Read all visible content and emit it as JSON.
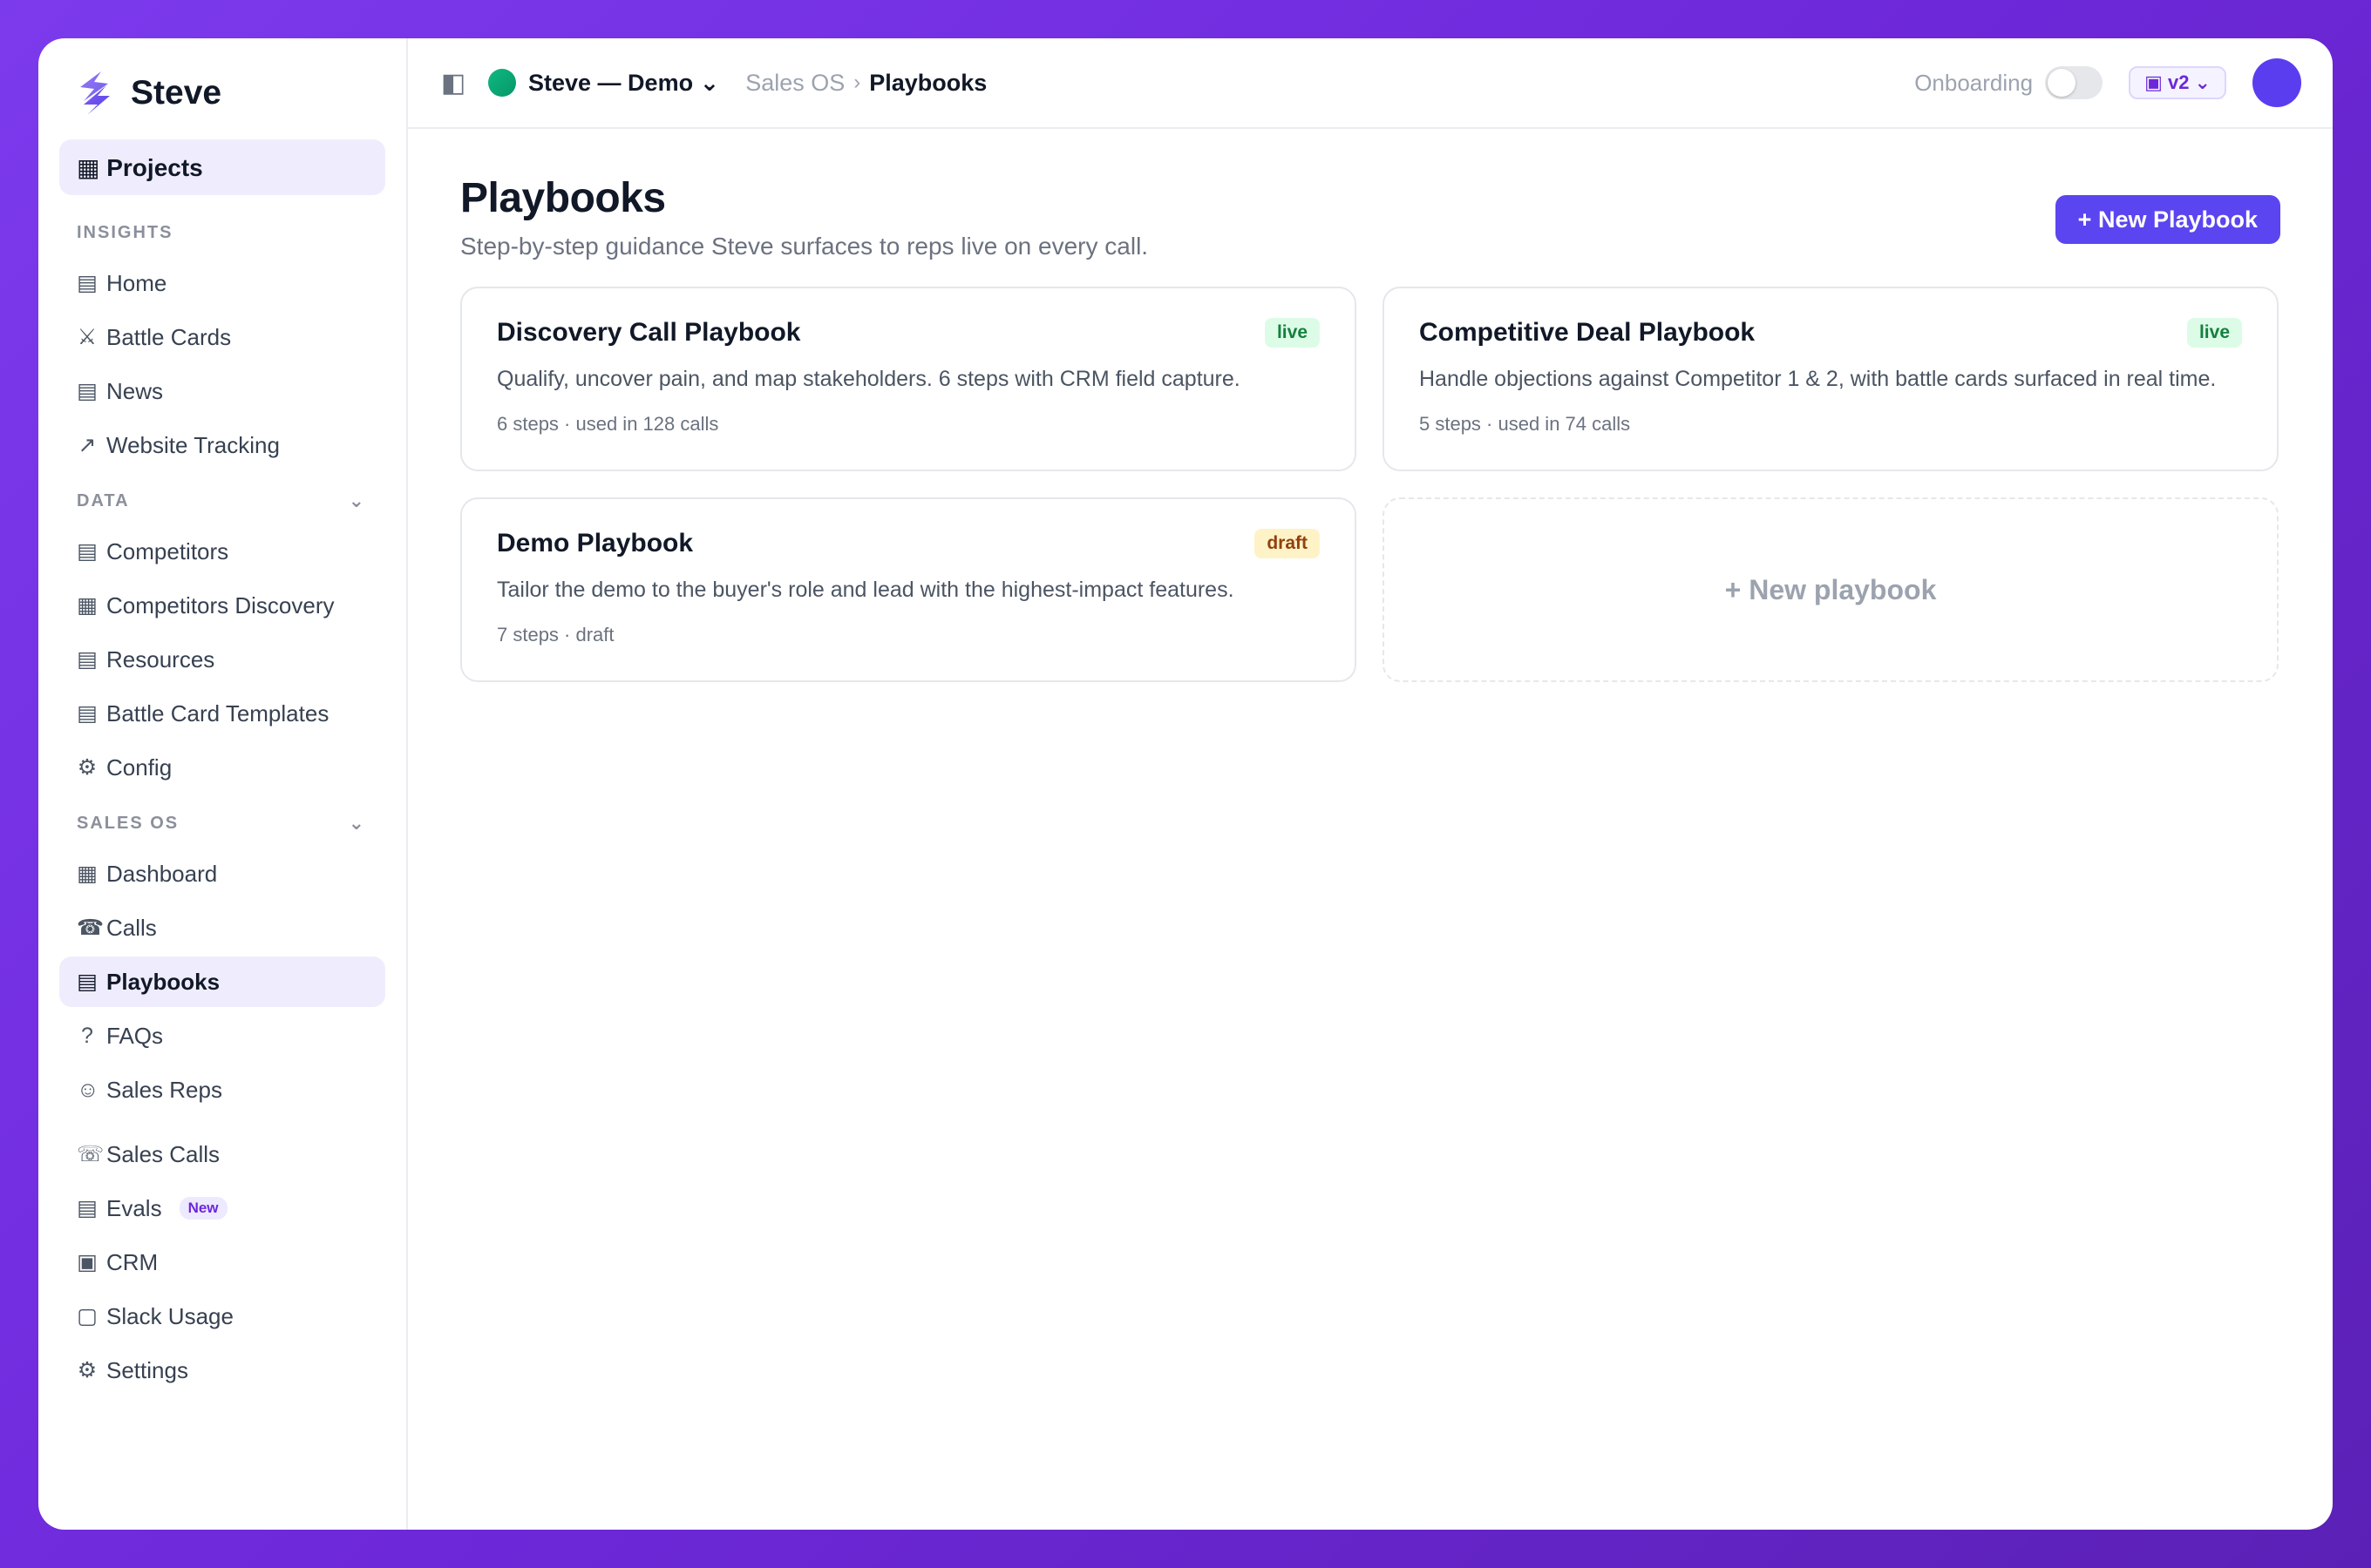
{
  "brand": {
    "name": "Steve",
    "logo_icon": "bolt-logo"
  },
  "sidebar": {
    "projects_label": "▦ Projects",
    "sections": [
      {
        "title": "INSIGHTS",
        "collapsible": false,
        "items": [
          {
            "icon": "▤",
            "label": "Home"
          },
          {
            "icon": "⚔",
            "label": "Battle Cards"
          },
          {
            "icon": "▤",
            "label": "News"
          },
          {
            "icon": "↗",
            "label": "Website Tracking"
          }
        ]
      },
      {
        "title": "DATA",
        "collapsible": true,
        "items": [
          {
            "icon": "▤",
            "label": "Competitors"
          },
          {
            "icon": "▦",
            "label": "Competitors Discovery"
          },
          {
            "icon": "▤",
            "label": "Resources"
          },
          {
            "icon": "▤",
            "label": "Battle Card Templates"
          },
          {
            "icon": "⚙",
            "label": "Config"
          }
        ]
      },
      {
        "title": "SALES OS",
        "collapsible": true,
        "items": [
          {
            "icon": "▦",
            "label": "Dashboard"
          },
          {
            "icon": "☎",
            "label": "Calls"
          },
          {
            "icon": "▤",
            "label": "Playbooks",
            "active": true
          },
          {
            "icon": "?",
            "label": "FAQs"
          },
          {
            "icon": "☺",
            "label": "Sales Reps"
          }
        ]
      }
    ],
    "footer_items": [
      {
        "icon": "☏",
        "label": "Sales Calls"
      },
      {
        "icon": "▤",
        "label": "Evals",
        "badge": "New"
      },
      {
        "icon": "▣",
        "label": "CRM"
      },
      {
        "icon": "▢",
        "label": "Slack Usage"
      },
      {
        "icon": "⚙",
        "label": "Settings"
      }
    ],
    "chevron": "⌄"
  },
  "topbar": {
    "panel_icon": "◧",
    "org_name": "Steve — Demo ⌄",
    "breadcrumb_parent": "Sales OS",
    "breadcrumb_sep": "›",
    "breadcrumb_current": "Playbooks",
    "onboarding_label": "Onboarding",
    "onboarding_enabled": false,
    "version_label": "▣ v2 ⌄",
    "accent_color": "#5b45f0"
  },
  "page": {
    "title": "Playbooks",
    "subtitle": "Step-by-step guidance Steve surfaces to reps live on every call.",
    "new_button_label": "+ New Playbook"
  },
  "playbooks": [
    {
      "title": "Discovery Call Playbook",
      "status": "live",
      "description": "Qualify, uncover pain, and map stakeholders. 6 steps with CRM field capture.",
      "meta": "6 steps · used in 128 calls"
    },
    {
      "title": "Competitive Deal Playbook",
      "status": "live",
      "description": "Handle objections against Competitor 1 & 2, with battle cards surfaced in real time.",
      "meta": "5 steps · used in 74 calls"
    },
    {
      "title": "Demo Playbook",
      "status": "draft",
      "description": "Tailor the demo to the buyer's role and lead with the highest-impact features.",
      "meta": "7 steps · draft"
    }
  ],
  "new_playbook_tile_label": "+ New playbook"
}
